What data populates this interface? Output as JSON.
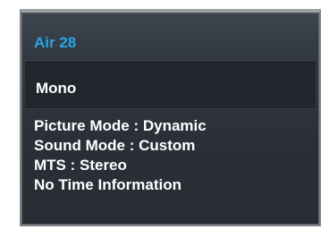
{
  "osd": {
    "channel": "Air 28",
    "audio": "Mono",
    "info": [
      "Picture Mode : Dynamic",
      "Sound Mode : Custom",
      "MTS : Stereo",
      "No Time Information"
    ]
  },
  "colors": {
    "channel_title": "#27a6e4",
    "panel_background": "#2b3038",
    "highlight_band": "#23262c",
    "text": "#ffffff"
  }
}
